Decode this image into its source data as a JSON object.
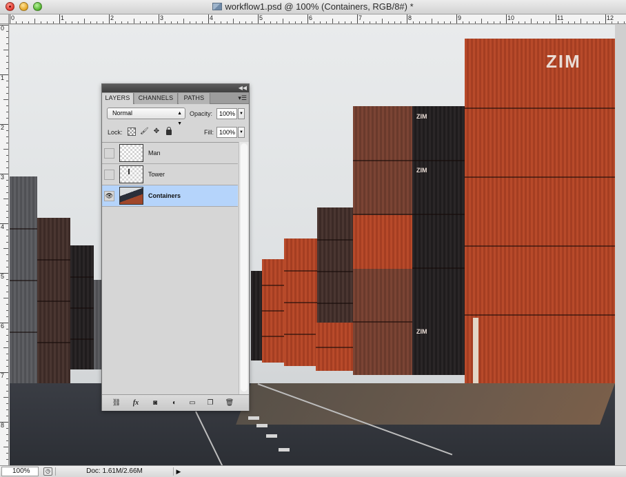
{
  "window": {
    "title": "workflow1.psd @ 100% (Containers, RGB/8#) *"
  },
  "ruler": {
    "top_ticks": [
      "0",
      "1",
      "2",
      "3",
      "4",
      "5",
      "6",
      "7",
      "8",
      "9",
      "10",
      "11",
      "12"
    ],
    "left_ticks": [
      "0",
      "1",
      "2",
      "3",
      "4",
      "5",
      "6",
      "7",
      "8"
    ]
  },
  "canvas": {
    "container_text_1": "ZIM",
    "container_text_2": "ZIM",
    "container_text_3": "ZIM",
    "container_text_4": "ZIM"
  },
  "layers_panel": {
    "tabs": [
      {
        "label": "LAYERS",
        "active": true
      },
      {
        "label": "CHANNELS",
        "active": false
      },
      {
        "label": "PATHS",
        "active": false
      }
    ],
    "blend_mode": "Normal",
    "opacity_label": "Opacity:",
    "opacity_value": "100%",
    "lock_label": "Lock:",
    "fill_label": "Fill:",
    "fill_value": "100%",
    "layers": [
      {
        "name": "Man",
        "visible": false,
        "selected": false
      },
      {
        "name": "Tower",
        "visible": false,
        "selected": false
      },
      {
        "name": "Containers",
        "visible": true,
        "selected": true
      }
    ]
  },
  "status_bar": {
    "zoom": "100%",
    "doc_info": "Doc: 1.61M/2.66M"
  }
}
